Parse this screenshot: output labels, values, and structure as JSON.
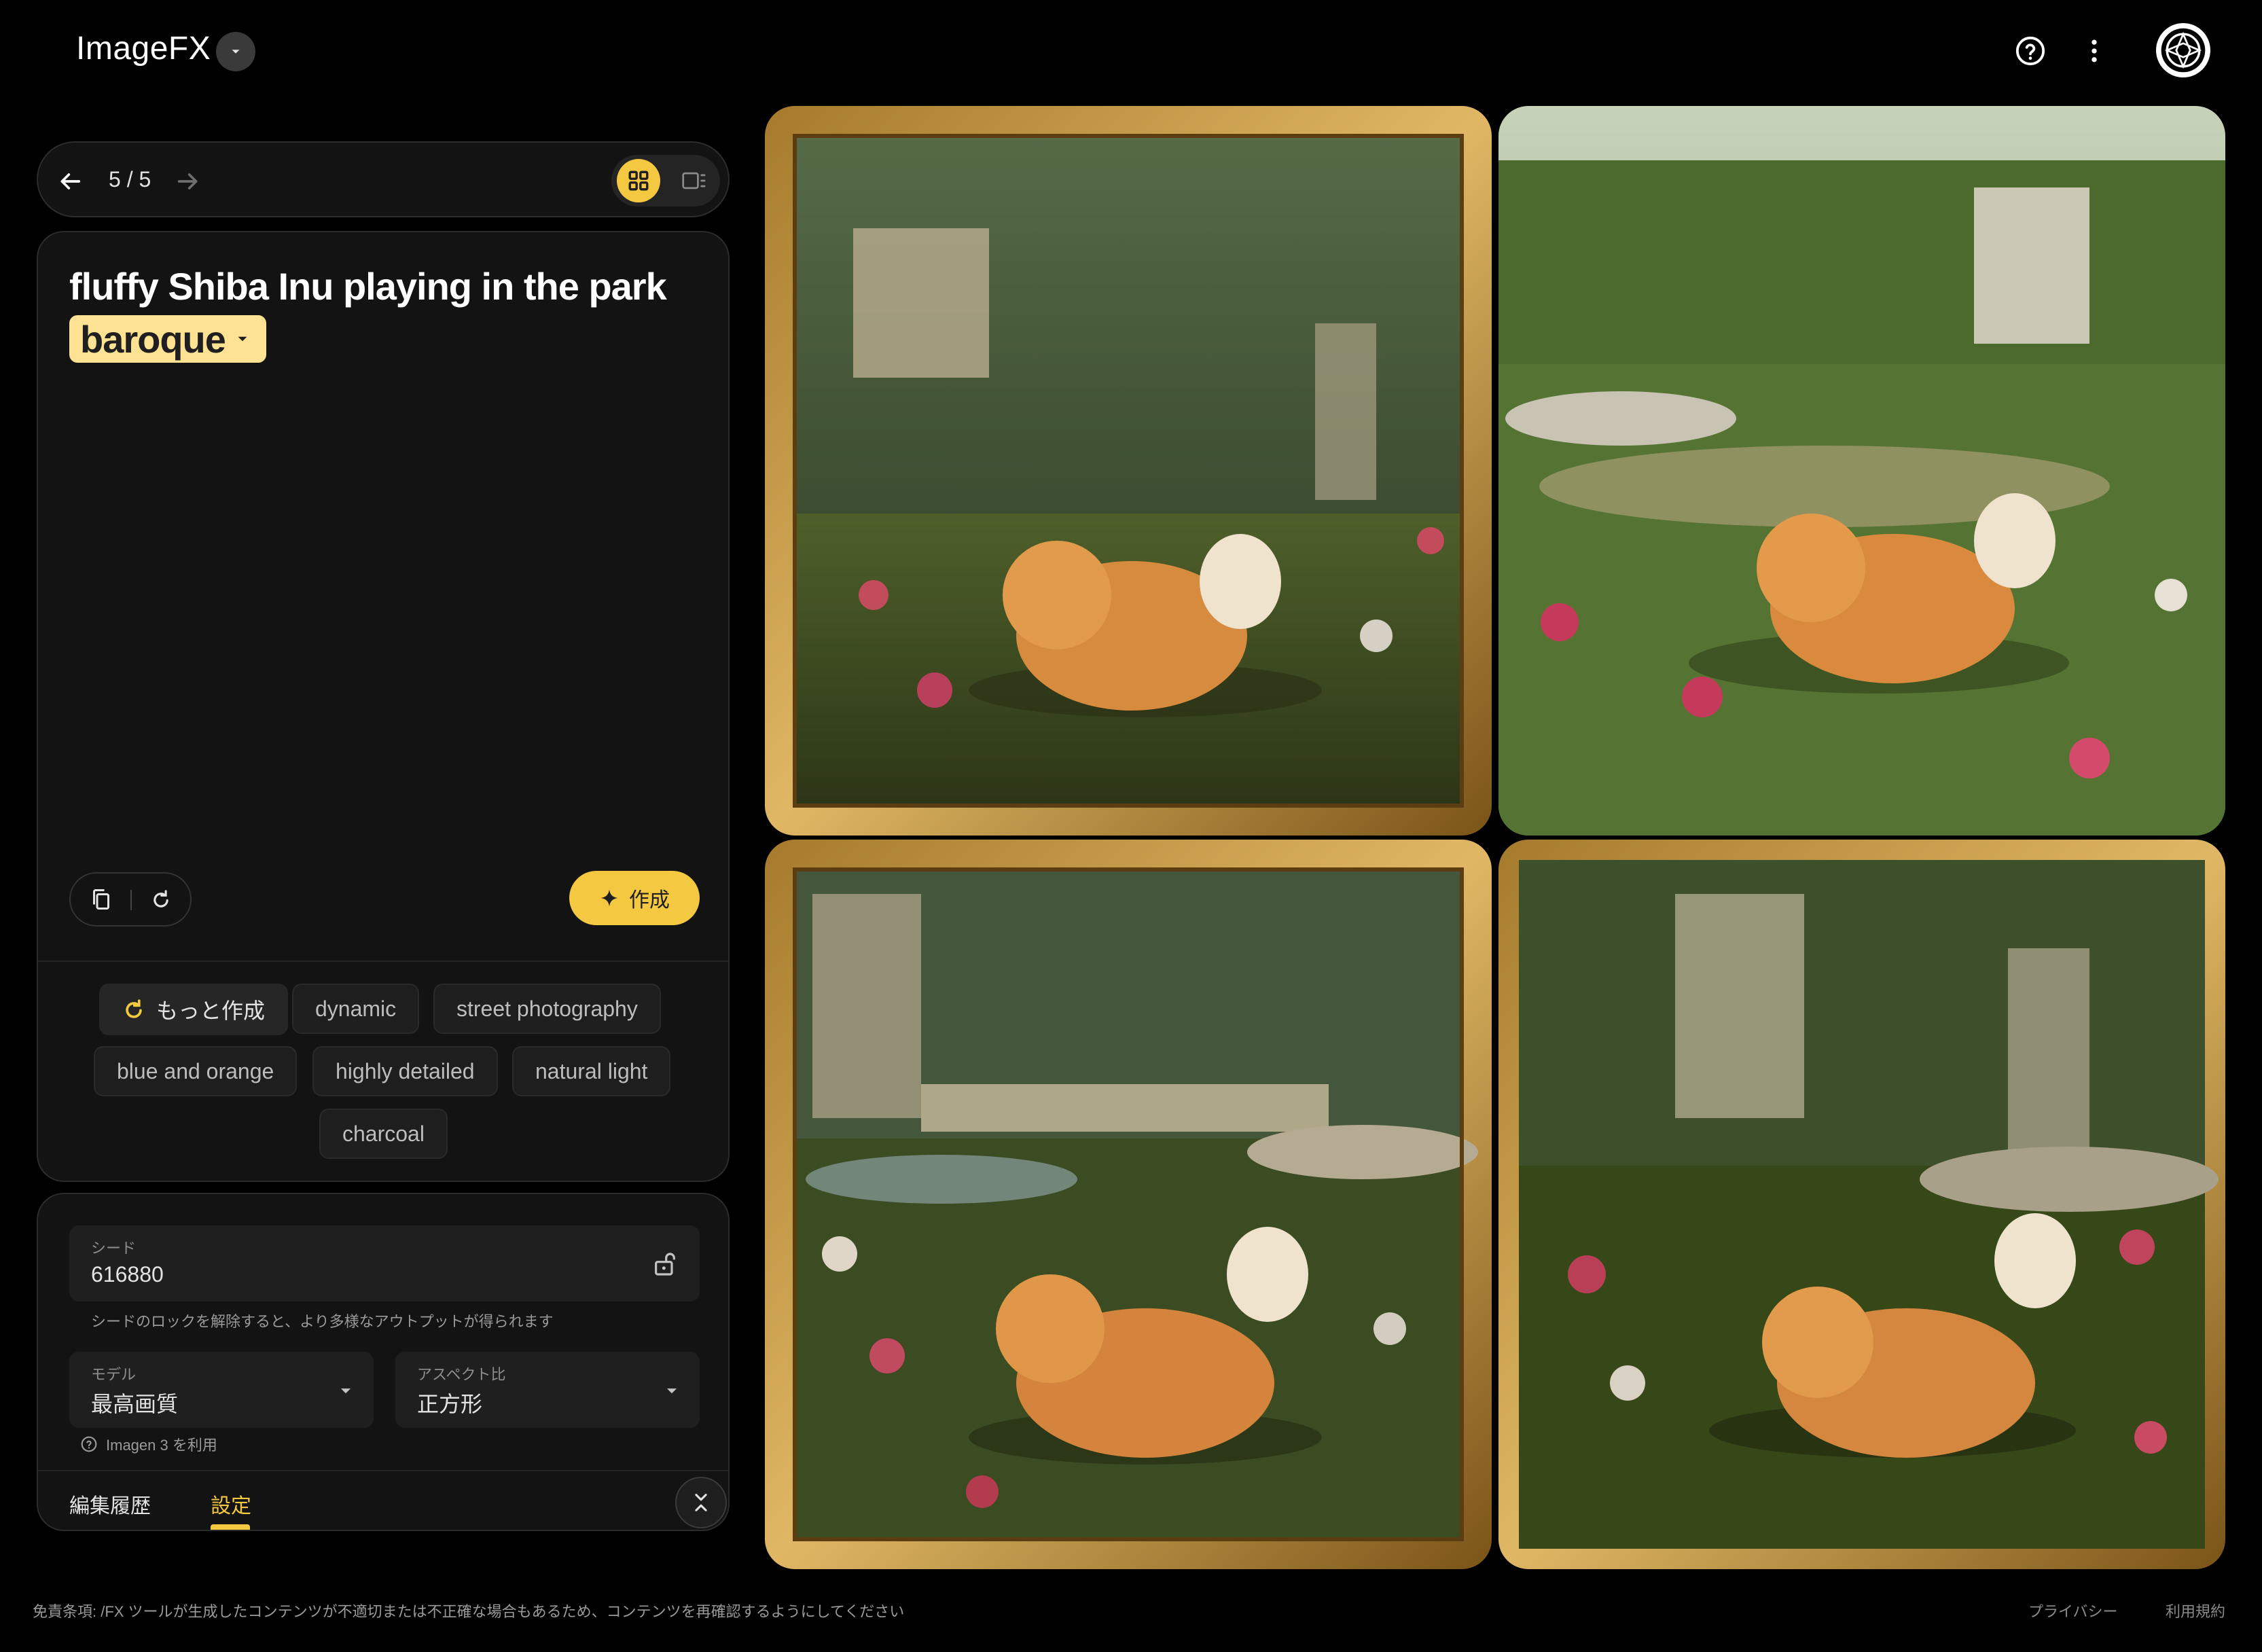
{
  "header": {
    "app_title": "ImageFX",
    "icons": [
      "chevron-down-icon",
      "help-icon",
      "more-vert-icon",
      "account-icon"
    ]
  },
  "nav": {
    "counter": "5 / 5"
  },
  "prompt": {
    "text": "fluffy Shiba Inu playing in the park",
    "style_chip": "baroque",
    "create_label": "作成"
  },
  "suggestions": {
    "more_label": "もっと作成",
    "chips": [
      "dynamic",
      "street photography",
      "blue and orange",
      "highly detailed",
      "natural light",
      "charcoal"
    ]
  },
  "settings": {
    "seed_label": "シード",
    "seed_value": "616880",
    "seed_hint": "シードのロックを解除すると、より多様なアウトプットが得られます",
    "model_label": "モデル",
    "model_value": "最高画質",
    "aspect_label": "アスペクト比",
    "aspect_value": "正方形",
    "model_note": "Imagen 3 を利用",
    "tabs": [
      "編集履歴",
      "設定"
    ],
    "active_tab": "設定"
  },
  "images": [
    {
      "id": 1
    },
    {
      "id": 2
    },
    {
      "id": 3
    },
    {
      "id": 4
    }
  ],
  "footer": {
    "disclaimer": "免責条項: /FX ツールが生成したコンテンツが不適切または不正確な場合もあるため、コンテンツを再確認するようにしてください",
    "privacy": "プライバシー",
    "terms": "利用規約"
  },
  "colors": {
    "accent": "#f5c842",
    "chip_bg": "#fde293",
    "panel_bg": "#131313"
  }
}
